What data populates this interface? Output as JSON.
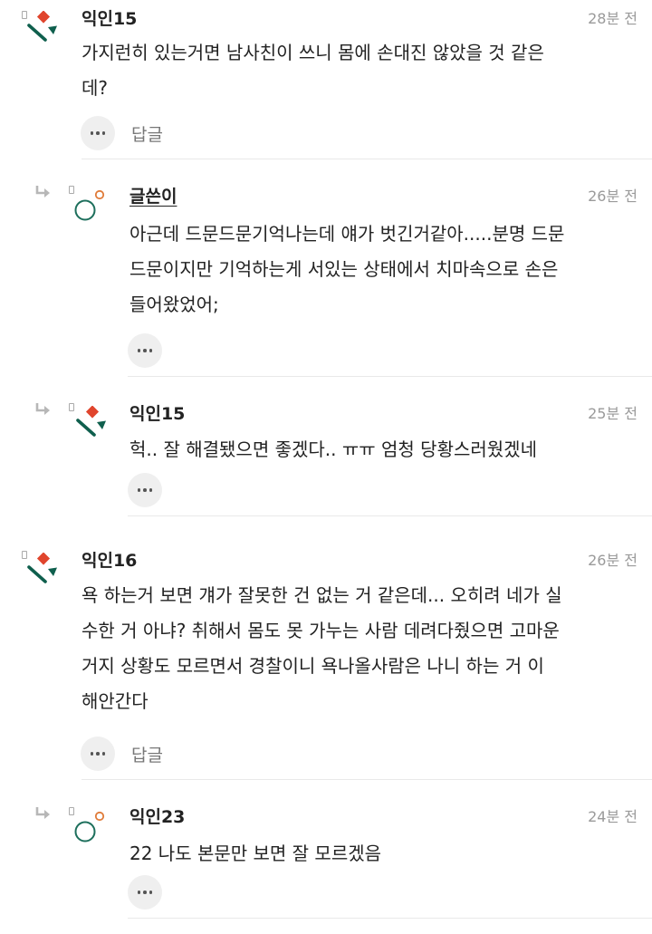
{
  "comments": [
    {
      "nickname": "익인15",
      "time": "28분 전",
      "avatar": "red-diamond-green-slash-avatar",
      "lines": [
        "가지런히 있는거면 남사친이 쓰니 몸에 손대진 않았을 것 같은",
        "데?"
      ],
      "reply_label": "답글",
      "more_icon": "more-dots-icon"
    },
    {
      "nickname": "글쓴이",
      "time": "26분 전",
      "avatar": "green-circle-orange-dot-avatar",
      "lines": [
        "아근데 드문드문기억나는데 얘가 벗긴거같아.....분명 드문",
        "드문이지만 기억하는게 서있는 상태에서 치마속으로 손은",
        "들어왔었어;"
      ],
      "more_icon": "more-dots-icon"
    },
    {
      "nickname": "익인15",
      "time": "25분 전",
      "avatar": "red-diamond-green-slash-avatar",
      "lines": [
        "헉.. 잘 해결됐으면 좋겠다.. ㅠㅠ 엄청 당황스러웠겠네"
      ],
      "more_icon": "more-dots-icon"
    },
    {
      "nickname": "익인16",
      "time": "26분 전",
      "avatar": "red-diamond-green-slash-avatar",
      "lines": [
        "욕 하는거 보면 걔가 잘못한 건 없는 거 같은데... 오히려 네가 실",
        "수한 거 아냐? 취해서 몸도 못 가누는 사람 데려다줬으면 고마운",
        "거지 상황도 모르면서 경찰이니 욕나올사람은 나니 하는 거 이",
        "해안간다"
      ],
      "reply_label": "답글",
      "more_icon": "more-dots-icon"
    },
    {
      "nickname": "익인23",
      "time": "24분 전",
      "avatar": "green-circle-orange-dot-avatar",
      "lines": [
        "22 나도 본문만 보면 잘 모르겠음"
      ],
      "more_icon": "more-dots-icon"
    }
  ],
  "colors": {
    "red": "#e0452d",
    "green": "#0f5f4d",
    "orange": "#e07b39",
    "teal": "#1d6f5c"
  }
}
